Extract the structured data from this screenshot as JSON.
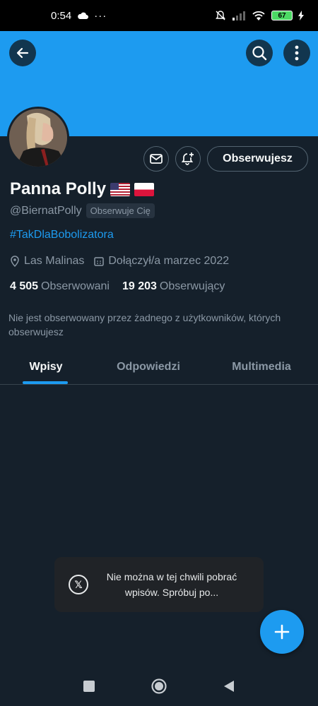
{
  "status_bar": {
    "time": "0:54",
    "battery": "67"
  },
  "profile": {
    "name": "Panna Polly",
    "handle": "@BiernatPolly",
    "follows_you": "Obserwuje Cię",
    "hashtag": "#TakDlaBobolizatora",
    "location": "Las Malinas",
    "joined": "Dołączył/a marzec 2022",
    "following_count": "4 505",
    "following_label": "Obserwowani",
    "followers_count": "19 203",
    "followers_label": "Obserwujący",
    "not_followed_note": "Nie jest obserwowany przez żadnego z użytkowników, których obserwujesz",
    "follow_button_label": "Obserwujesz"
  },
  "tabs": [
    {
      "label": "Wpisy",
      "active": true
    },
    {
      "label": "Odpowiedzi",
      "active": false
    },
    {
      "label": "Multimedia",
      "active": false
    }
  ],
  "toast": {
    "message": "Nie można w tej chwili pobrać wpisów. Spróbuj po..."
  },
  "colors": {
    "accent": "#1d9bf0",
    "background": "#15202b",
    "muted_text": "#8b98a5"
  },
  "icons": [
    "back-arrow-icon",
    "search-icon",
    "more-vertical-icon",
    "mail-icon",
    "bell-plus-icon",
    "location-pin-icon",
    "calendar-icon",
    "x-logo-icon",
    "plus-icon"
  ]
}
